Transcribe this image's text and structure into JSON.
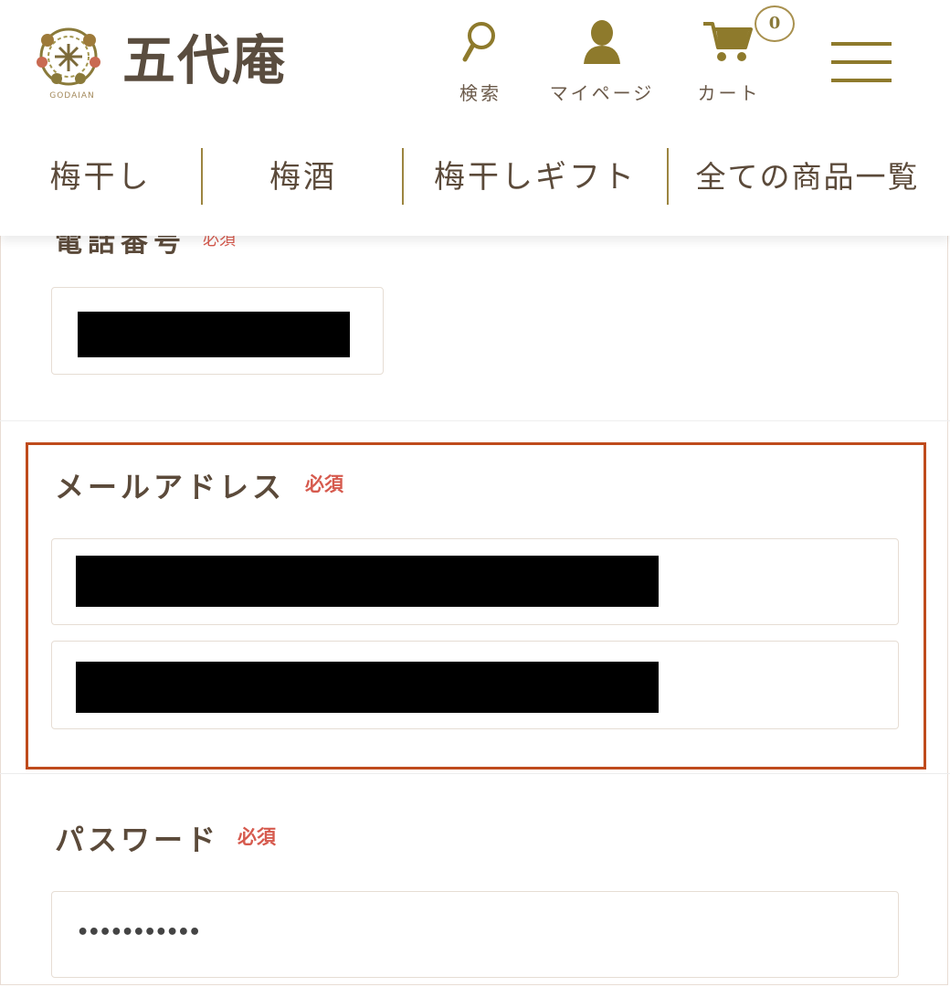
{
  "header": {
    "logo": {
      "text": "五代庵",
      "sub": "GODAIAN"
    },
    "buttons": [
      {
        "label": "検索",
        "icon": "search-icon"
      },
      {
        "label": "マイページ",
        "icon": "user-icon"
      },
      {
        "label": "カート",
        "icon": "cart-icon"
      }
    ],
    "cart_count": "0",
    "menu_icon": "hamburger-menu-icon"
  },
  "nav": {
    "items": [
      "梅干し",
      "梅酒",
      "梅干しギフト",
      "全ての商品一覧"
    ]
  },
  "form": {
    "phone": {
      "label": "電話番号",
      "required": "必須"
    },
    "email": {
      "label": "メールアドレス",
      "required": "必須"
    },
    "password": {
      "label": "パスワード",
      "required": "必須",
      "value": "•••••••••••"
    }
  },
  "colors": {
    "brand_gold": "#8e7a2c",
    "text_brown": "#5b4a3a",
    "required_red": "#d65a4e",
    "highlight_border": "#bf4b1c"
  }
}
